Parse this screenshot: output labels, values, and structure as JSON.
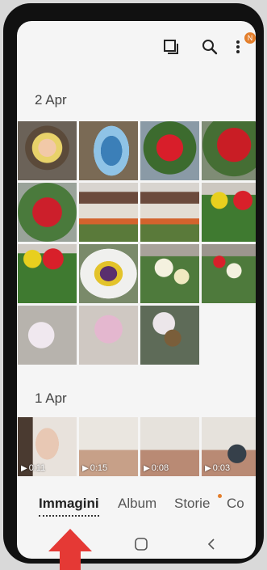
{
  "topbar": {
    "icons": [
      "select-icon",
      "search-icon",
      "more-icon"
    ],
    "badge": "N"
  },
  "sections": [
    {
      "date": "2 Apr"
    },
    {
      "date": "1 Apr"
    }
  ],
  "videos": [
    {
      "duration": "0:11"
    },
    {
      "duration": "0:15"
    },
    {
      "duration": "0:08"
    },
    {
      "duration": "0:03"
    }
  ],
  "tabs": [
    {
      "label": "Immagini",
      "active": true
    },
    {
      "label": "Album",
      "active": false
    },
    {
      "label": "Storie",
      "active": false,
      "dot": true
    },
    {
      "label": "Co",
      "active": false
    }
  ],
  "navbar": [
    "recents-icon",
    "home-icon",
    "back-icon"
  ],
  "colors": {
    "accent": "#e37e2b",
    "annotation": "#e53935"
  }
}
